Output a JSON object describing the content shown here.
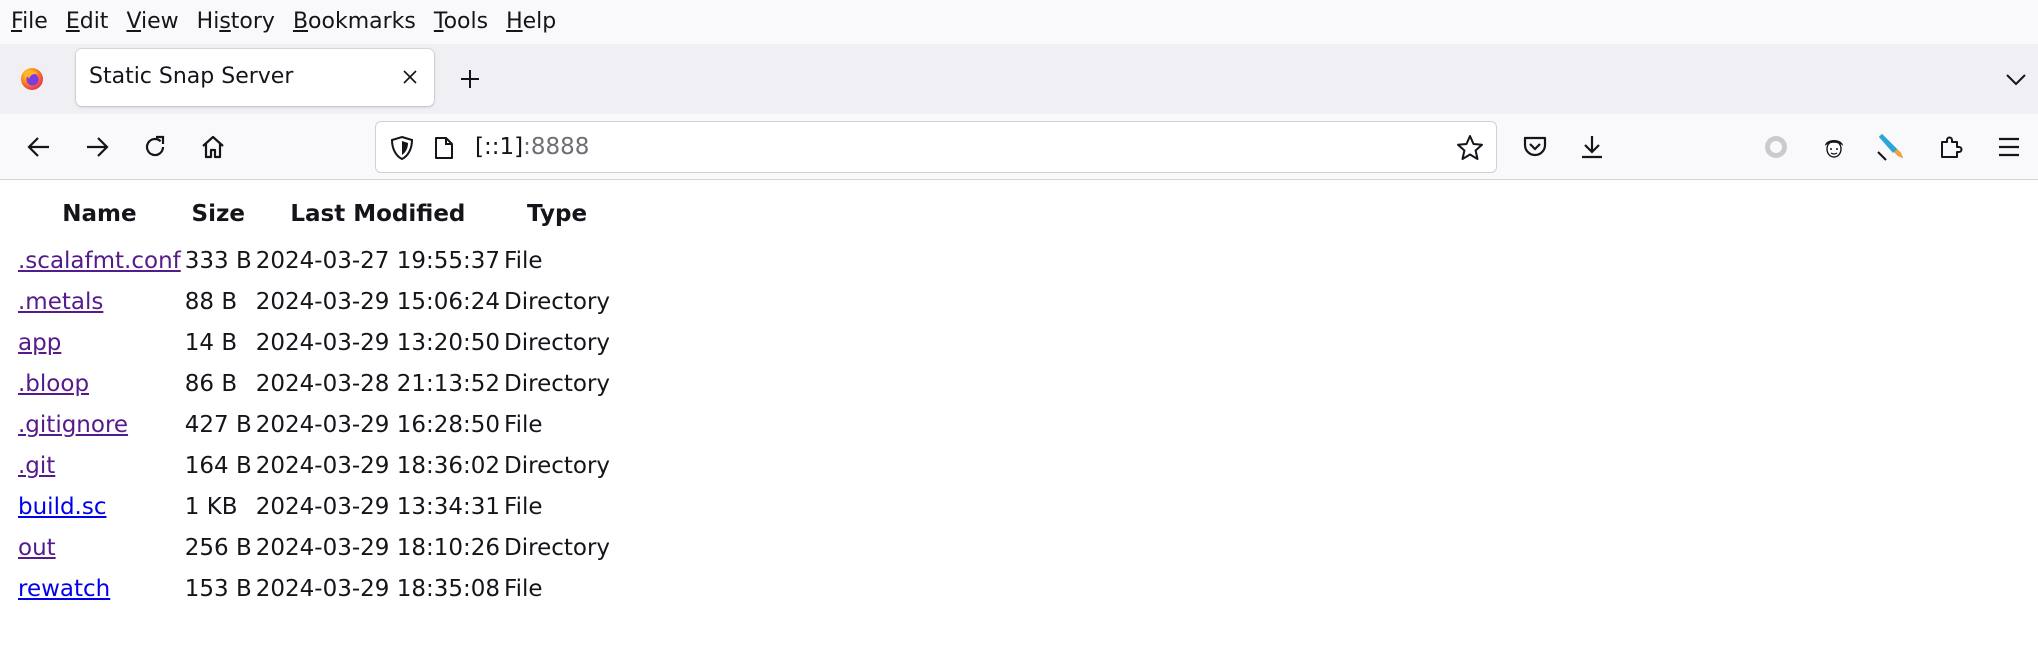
{
  "menubar": {
    "items": [
      "File",
      "Edit",
      "View",
      "History",
      "Bookmarks",
      "Tools",
      "Help"
    ],
    "mnemonics": [
      "F",
      "E",
      "V",
      "s",
      "B",
      "T",
      "H"
    ]
  },
  "tabs": {
    "active_title": "Static Snap Server"
  },
  "urlbar": {
    "host": "[::1]",
    "port": ":8888"
  },
  "listing": {
    "headers": [
      "Name",
      "Size",
      "Last Modified",
      "Type"
    ],
    "rows": [
      {
        "name": ".scalafmt.conf",
        "size": "333 B",
        "modified": "2024-03-27 19:55:37",
        "type": "File",
        "visited": true
      },
      {
        "name": ".metals",
        "size": "88 B",
        "modified": "2024-03-29 15:06:24",
        "type": "Directory",
        "visited": true
      },
      {
        "name": "app",
        "size": "14 B",
        "modified": "2024-03-29 13:20:50",
        "type": "Directory",
        "visited": true
      },
      {
        "name": ".bloop",
        "size": "86 B",
        "modified": "2024-03-28 21:13:52",
        "type": "Directory",
        "visited": true
      },
      {
        "name": ".gitignore",
        "size": "427 B",
        "modified": "2024-03-29 16:28:50",
        "type": "File",
        "visited": true
      },
      {
        "name": ".git",
        "size": "164 B",
        "modified": "2024-03-29 18:36:02",
        "type": "Directory",
        "visited": true
      },
      {
        "name": "build.sc",
        "size": "1 KB",
        "modified": "2024-03-29 13:34:31",
        "type": "File",
        "visited": false
      },
      {
        "name": "out",
        "size": "256 B",
        "modified": "2024-03-29 18:10:26",
        "type": "Directory",
        "visited": true
      },
      {
        "name": "rewatch",
        "size": "153 B",
        "modified": "2024-03-29 18:35:08",
        "type": "File",
        "visited": false
      }
    ]
  },
  "colors": {
    "link_visited": "#551a8b",
    "link_unvisited": "#0000ee",
    "chrome_bg": "#f9f9fb",
    "tabstrip_bg": "#f0f0f4"
  },
  "icons": {
    "tab": [
      "firefox-logo-icon",
      "close-icon",
      "plus-icon",
      "chevron-down-icon"
    ],
    "nav": [
      "back-arrow-icon",
      "forward-arrow-icon",
      "reload-icon",
      "home-icon"
    ],
    "urlbar": [
      "shield-icon",
      "page-icon",
      "star-icon"
    ],
    "toolbar": [
      "pocket-icon",
      "download-icon",
      "circle-extension-icon",
      "avatar-extension-icon",
      "pencil-extension-icon",
      "puzzle-icon",
      "hamburger-menu-icon"
    ]
  }
}
